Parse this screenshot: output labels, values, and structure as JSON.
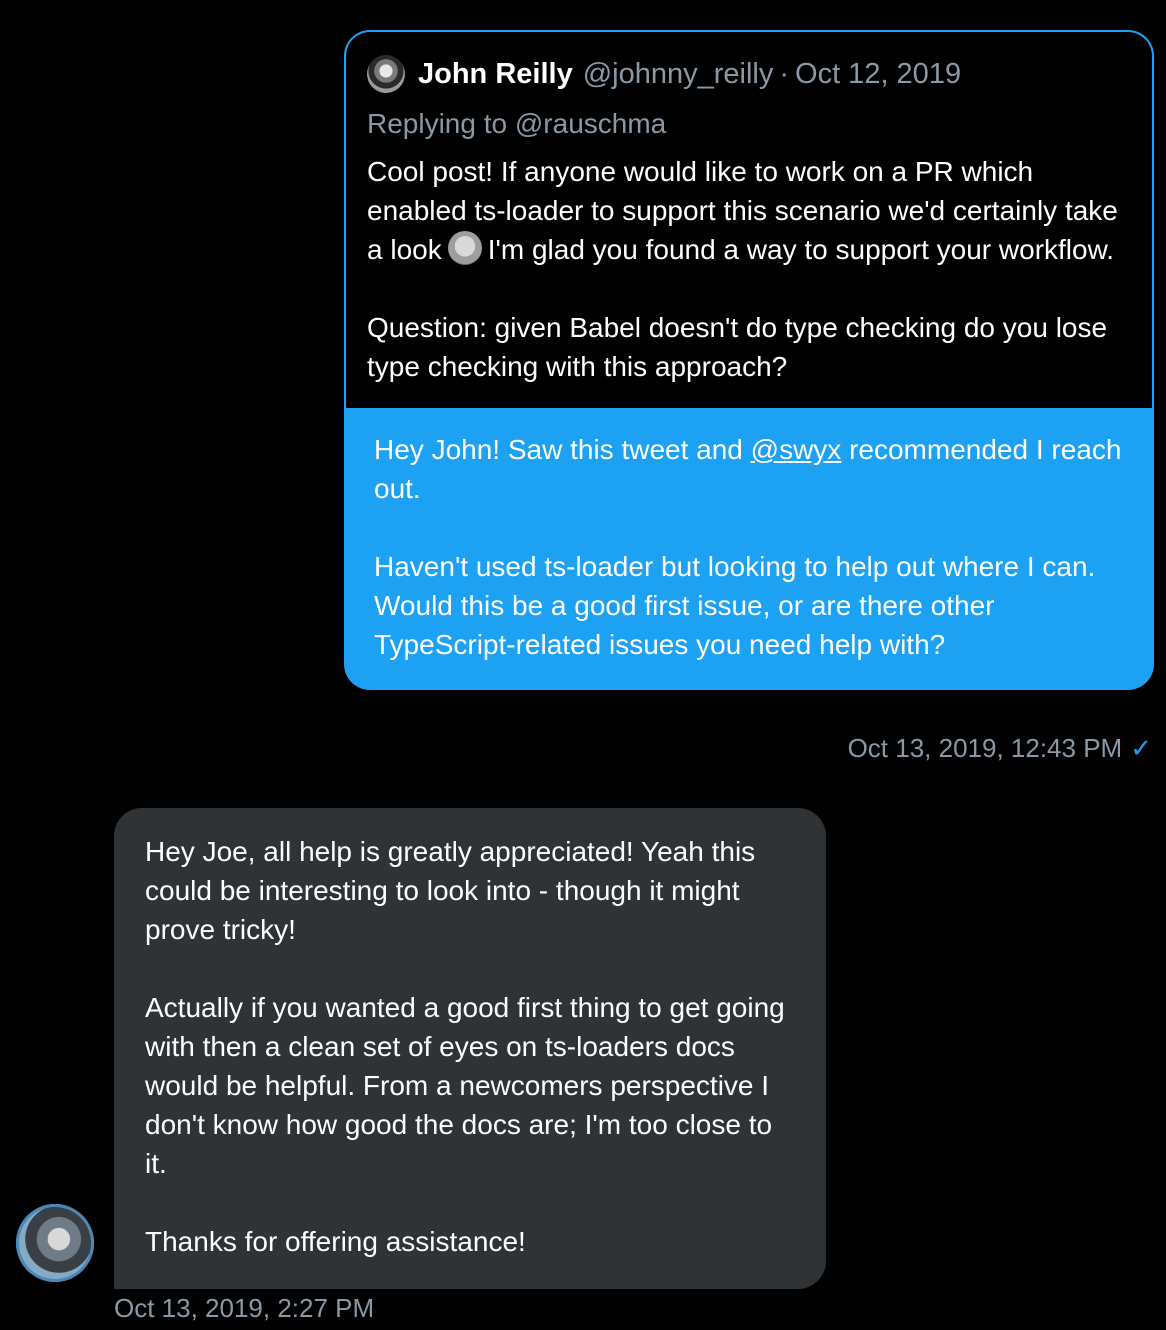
{
  "quoted_tweet": {
    "author_name": "John Reilly",
    "author_handle": "@johnny_reilly",
    "separator": "·",
    "date": "Oct 12, 2019",
    "replying_prefix": "Replying to ",
    "replying_to": "@rauschma",
    "paragraph_1_before_emoji": "Cool post! If anyone would like to work on a PR which enabled ts-loader to support this scenario we'd certainly take a look",
    "emoji": "smiling-face-emoji",
    "paragraph_1_after_emoji": "I'm glad you found a way to support your workflow.",
    "paragraph_2": "Question: given Babel doesn't do type checking do you lose type checking with this approach?"
  },
  "outgoing_message": {
    "p1_before": "Hey John! Saw this tweet and ",
    "p1_mention": "@swyx",
    "p1_after": " recommended I reach out.",
    "p2": "Haven't used ts-loader but looking to help out where I can. Would this be a good first issue, or are there other TypeScript-related issues you need help with?",
    "timestamp": "Oct 13, 2019, 12:43 PM",
    "status_icon": "✓"
  },
  "incoming_message": {
    "p1": "Hey Joe, all help is greatly appreciated! Yeah this could be interesting to look into - though it might prove tricky!",
    "p2": "Actually if you wanted a good first thing to get going with then a clean set of eyes on ts-loaders docs would be helpful. From a newcomers perspective I don't know how good the docs are; I'm too close to it.",
    "p3": "Thanks for offering assistance!",
    "timestamp": "Oct 13, 2019, 2:27 PM"
  },
  "colors": {
    "background": "#000000",
    "accent": "#1da1f2",
    "incoming_bubble": "#2f3336",
    "muted_text": "#8b98a5"
  }
}
